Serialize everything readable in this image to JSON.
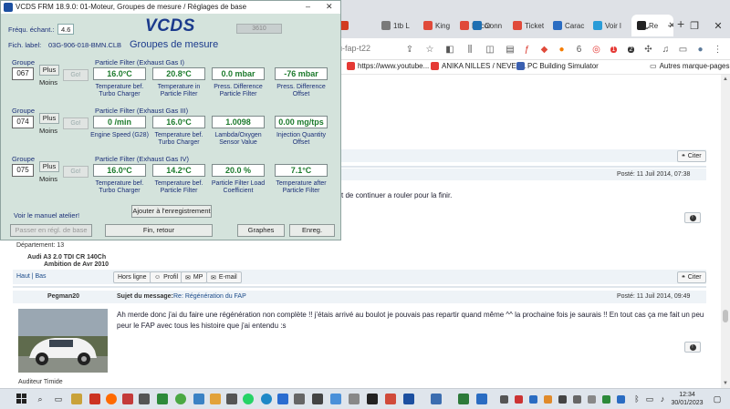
{
  "browser": {
    "tabs": [
      {
        "label": "",
        "color": "#d23b1f"
      },
      {
        "label": "R",
        "color": "#3a6ea5"
      },
      {
        "label": "",
        "color": "#ff6a00"
      },
      {
        "label": "1tb L",
        "color": "#7a7a7a"
      },
      {
        "label": "King",
        "color": "#e04a3a"
      },
      {
        "label": "Encor",
        "color": "#e04a3a"
      },
      {
        "label": "Conn",
        "color": "#1f6fb2"
      },
      {
        "label": "Ticket",
        "color": "#e04a3a"
      },
      {
        "label": "Carac",
        "color": "#2a6cc2"
      },
      {
        "label": "Voir l",
        "color": "#2a9cd8"
      },
      {
        "label": "Re",
        "color": "#222"
      }
    ],
    "url_fragment": "u-fap-t22",
    "bookmarks": [
      {
        "label": "https://www.youtube...",
        "color": "#e53935"
      },
      {
        "label": "ANIKA NILLES / NEVEL...",
        "color": "#e53935"
      },
      {
        "label": "PC Building Simulator",
        "color": "#3a5fb0"
      }
    ],
    "other_bookmarks": "Autres marque-pages",
    "toolbar_badge_6": "6",
    "toolbar_badge_red": "1",
    "toolbar_badge_2": "2"
  },
  "vcds": {
    "title": "VCDS FRM 18.9.0: 01-Moteur,  Groupes de mesure / Réglages de base",
    "logo": "VCDS",
    "subtitle": "Groupes de mesure",
    "freq_label": "Fréqu. échant.:",
    "freq_value": "4.6",
    "grey_field": "3610",
    "fich_label": "Fich. label:",
    "fich_value": "03G-906-018-BMN.CLB",
    "group_word": "Groupe",
    "plus": "Plus",
    "moins": "Moins",
    "go": "Go!",
    "groups": [
      {
        "number": "067",
        "section": "Particle Filter (Exhaust Gas I)",
        "values": [
          "16.0°C",
          "20.8°C",
          "0.0 mbar",
          "-76 mbar"
        ],
        "labels": [
          "Temperature bef. Turbo Charger",
          "Temperature in Particle Filter",
          "Press. Difference Particle Filter",
          "Press. Difference Offset"
        ]
      },
      {
        "number": "074",
        "section": "Particle Filter (Exhaust Gas III)",
        "values": [
          "0 /min",
          "16.0°C",
          "1.0098",
          "0.00 mg/tps"
        ],
        "labels": [
          "Engine Speed (G28)",
          "Temperature bef. Turbo Charger",
          "Lambda/Oxygen Sensor Value",
          "Injection Quantity Offset"
        ]
      },
      {
        "number": "075",
        "section": "Particle Filter (Exhaust Gas IV)",
        "values": [
          "16.0°C",
          "14.2°C",
          "20.0 %",
          "7.1°C"
        ],
        "labels": [
          "Temperature bef. Turbo Charger",
          "Temperature bef. Particle Filter",
          "Particle Filter Load Coefficient",
          "Temperature after Particle Filter"
        ]
      }
    ],
    "manual_link": "Voir le manuel atelier!",
    "add_record": "Ajouter à l'enregistrement",
    "basic_settings": "Passer en régl. de base",
    "done_back": "Fin, retour",
    "graphs": "Graphes",
    "record": "Enreg."
  },
  "forum": {
    "citer": "Citer",
    "post1_date": "Posté: 11 Juil 2014, 07:38",
    "post1_text": "st de continuer a rouler pour la finir.",
    "departement": "Département: 13",
    "car_line1": "Audi A3 2.0 TDI CR 140Ch",
    "car_line2": "Ambition de Avr 2010",
    "haut_bas": "Haut | Bas",
    "hors_ligne": "Hors ligne",
    "profil": "Profil",
    "mp": "MP",
    "email": "E-mail",
    "author": "Pegman20",
    "subject_label": "Sujet du message:",
    "subject_value": "Re: Régénération du FAP",
    "post2_date": "Posté: 11 Juil 2014, 09:49",
    "post2_text_line1": "Ah merde donc j'ai du faire une régénération non complète !! j'étais arrivé au boulot je pouvais pas repartir quand même ^^ la prochaine fois je saurais !! En tout cas ça me fait un peu",
    "post2_text_line2": "peur le FAP avec tous les histoire que j'ai entendu :s",
    "rank": "Auditeur Timide"
  },
  "taskbar": {
    "time": "12:34",
    "date": "30/01/2023"
  }
}
